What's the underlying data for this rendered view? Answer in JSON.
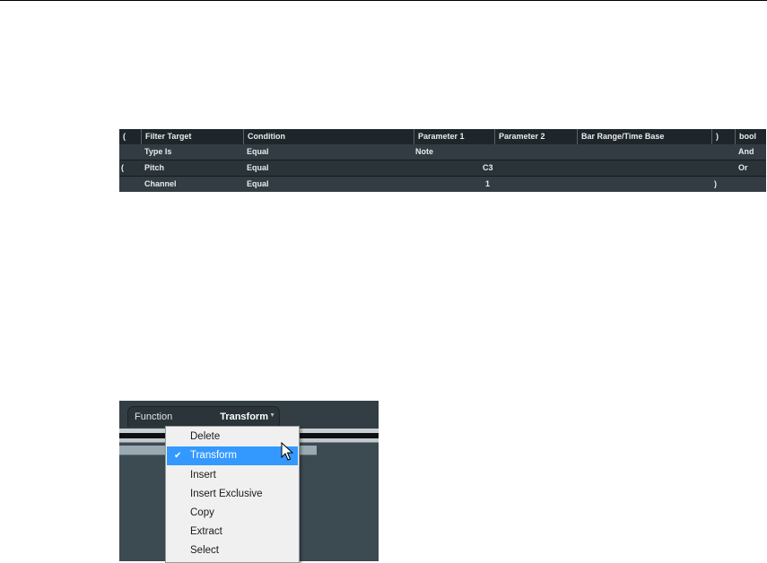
{
  "filter_table": {
    "headers": [
      "(",
      "Filter Target",
      "Condition",
      "Parameter 1",
      "Parameter 2",
      "Bar Range/Time Base",
      ")",
      "bool"
    ],
    "rows": [
      {
        "open_paren": "",
        "filter_target": "Type Is",
        "condition": "Equal",
        "parameter1": "Note",
        "parameter2": "",
        "bar_range": "",
        "close_paren": "",
        "bool": "And"
      },
      {
        "open_paren": "(",
        "filter_target": "Pitch",
        "condition": "Equal",
        "parameter1": "C3",
        "parameter2": "",
        "bar_range": "",
        "close_paren": "",
        "bool": "Or"
      },
      {
        "open_paren": "",
        "filter_target": "Channel",
        "condition": "Equal",
        "parameter1": "1",
        "parameter2": "",
        "bar_range": "",
        "close_paren": ")",
        "bool": ""
      }
    ]
  },
  "function_panel": {
    "label": "Function",
    "value": "Transform",
    "chevron_icon": "chevron-down-icon"
  },
  "dropdown_menu": {
    "selected_index": 1,
    "check_icon": "checkmark-icon",
    "items": [
      "Delete",
      "Transform",
      "Insert",
      "Insert Exclusive",
      "Copy",
      "Extract",
      "Select"
    ]
  },
  "colors": {
    "table_background": "#2b343a",
    "panel_background": "#3c4a51",
    "menu_highlight": "#3399ff"
  }
}
